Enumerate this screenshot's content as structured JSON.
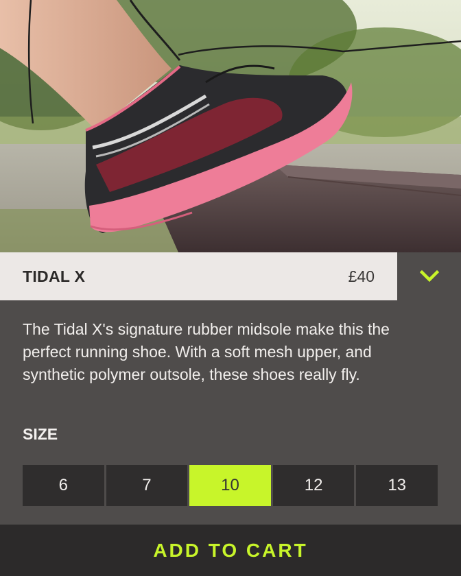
{
  "hero": {
    "image": "pink-black-running-shoe-on-bench-photo"
  },
  "product": {
    "name": "TIDAL X",
    "price": "£40",
    "toggle_icon": "chevron-down-icon",
    "description": "The Tidal X's signature rubber midsole make this the perfect running shoe. With a soft mesh upper, and synthetic polymer outsole, these shoes really fly."
  },
  "size": {
    "label": "SIZE",
    "options": [
      "6",
      "7",
      "10",
      "12",
      "13"
    ],
    "selected": "10"
  },
  "cart": {
    "label": "ADD TO CART"
  },
  "colors": {
    "accent": "#c8f52a",
    "panel": "#4f4c4b",
    "title_bg": "#ece8e6",
    "dark": "#2c2a2a"
  }
}
